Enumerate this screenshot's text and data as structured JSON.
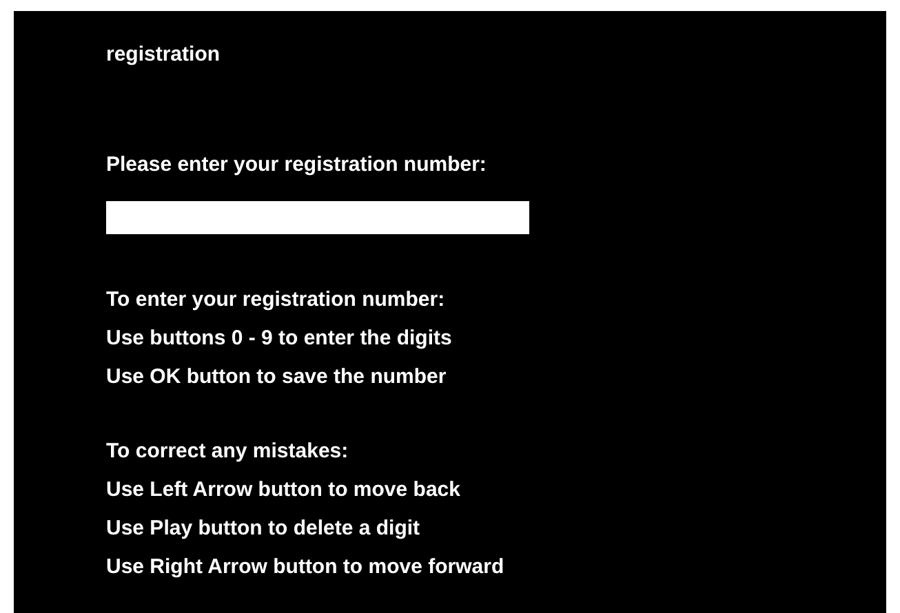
{
  "title": "registration",
  "prompt": "Please enter your registration number:",
  "instruction_groups": [
    {
      "lines": [
        "To enter your registration number:",
        "Use buttons 0 - 9 to enter the digits",
        "Use OK button to save the number"
      ]
    },
    {
      "lines": [
        "To correct any mistakes:",
        "Use Left Arrow button to move back",
        "Use Play button to delete a digit",
        "Use Right Arrow button to move forward"
      ]
    }
  ]
}
